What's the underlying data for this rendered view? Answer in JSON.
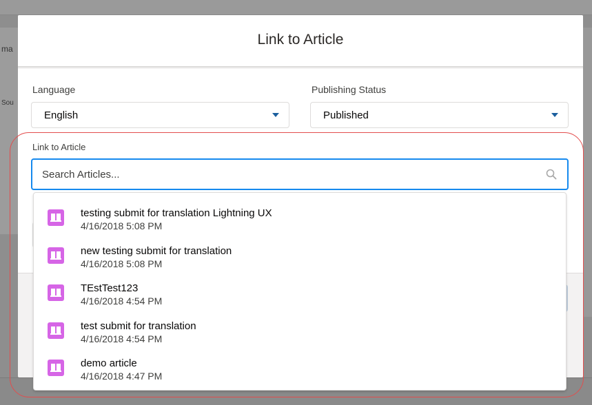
{
  "modal": {
    "title": "Link to Article"
  },
  "language": {
    "label": "Language",
    "value": "English"
  },
  "publishing_status": {
    "label": "Publishing Status",
    "value": "Published"
  },
  "link_section": {
    "label": "Link to Article"
  },
  "search": {
    "placeholder": "Search Articles..."
  },
  "results": [
    {
      "title": "testing submit for translation Lightning UX",
      "date": "4/16/2018 5:08 PM",
      "icon": "article-icon"
    },
    {
      "title": "new testing submit for translation",
      "date": "4/16/2018 5:08 PM",
      "icon": "article-icon"
    },
    {
      "title": "TEstTest123",
      "date": "4/16/2018 4:54 PM",
      "icon": "article-icon"
    },
    {
      "title": "test submit for translation",
      "date": "4/16/2018 4:54 PM",
      "icon": "article-icon"
    },
    {
      "title": "demo article",
      "date": "4/16/2018 4:47 PM",
      "icon": "article-icon"
    }
  ],
  "background": {
    "edge_text_1": "ma",
    "edge_text_2": "Sou"
  },
  "colors": {
    "accent": "#1589ee",
    "article_icon": "#d665e6",
    "highlight": "#e34c4c"
  }
}
